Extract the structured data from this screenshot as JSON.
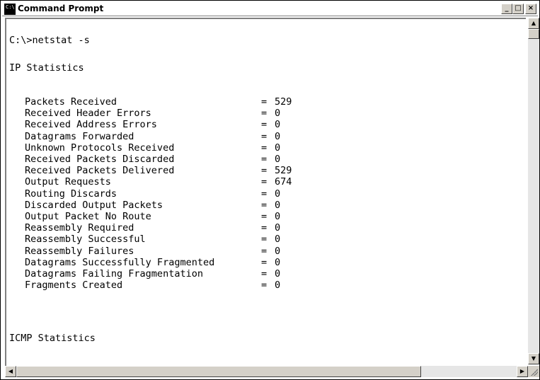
{
  "window": {
    "title": "Command Prompt",
    "icon": "cmd-icon",
    "icon_text": "C:\\",
    "buttons": {
      "minimize": "_",
      "maximize": "□",
      "close": "×"
    }
  },
  "console": {
    "command": "C:\\>netstat -s",
    "section_ip": "IP Statistics",
    "stats": [
      {
        "label": "Packets Received",
        "value": "529"
      },
      {
        "label": "Received Header Errors",
        "value": "0"
      },
      {
        "label": "Received Address Errors",
        "value": "0"
      },
      {
        "label": "Datagrams Forwarded",
        "value": "0"
      },
      {
        "label": "Unknown Protocols Received",
        "value": "0"
      },
      {
        "label": "Received Packets Discarded",
        "value": "0"
      },
      {
        "label": "Received Packets Delivered",
        "value": "529"
      },
      {
        "label": "Output Requests",
        "value": "674"
      },
      {
        "label": "Routing Discards",
        "value": "0"
      },
      {
        "label": "Discarded Output Packets",
        "value": "0"
      },
      {
        "label": "Output Packet No Route",
        "value": "0"
      },
      {
        "label": "Reassembly Required",
        "value": "0"
      },
      {
        "label": "Reassembly Successful",
        "value": "0"
      },
      {
        "label": "Reassembly Failures",
        "value": "0"
      },
      {
        "label": "Datagrams Successfully Fragmented",
        "value": "0"
      },
      {
        "label": "Datagrams Failing Fragmentation",
        "value": "0"
      },
      {
        "label": "Fragments Created",
        "value": "0"
      }
    ],
    "section_icmp": "ICMP Statistics"
  },
  "scrollbars": {
    "up_arrow": "▲",
    "down_arrow": "▼",
    "left_arrow": "◀",
    "right_arrow": "▶"
  }
}
